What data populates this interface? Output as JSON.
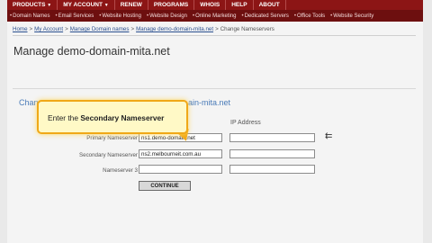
{
  "nav": {
    "top": [
      "PRODUCTS",
      "MY ACCOUNT",
      "RENEW",
      "PROGRAMS",
      "WHOIS",
      "HELP",
      "ABOUT"
    ],
    "sub": [
      "Domain Names",
      "Email Services",
      "Website Hosting",
      "Website Design",
      "Online Marketing",
      "Dedicated Servers",
      "Office Tools",
      "Website Security"
    ]
  },
  "breadcrumb": {
    "home": "Home",
    "my_account": "My Account",
    "manage_domains": "Manage Domain names",
    "manage_domain": "Manage demo-domain-mita.net",
    "current": "Change Nameservers",
    "separator": ">"
  },
  "page_title": "Manage demo-domain-mita.net",
  "section": {
    "title_left": "Chang",
    "title_right": "ain-mita.net"
  },
  "columns": {
    "ip": "IP Address"
  },
  "rows": [
    {
      "label": "Primary Nameserver",
      "value": "ns1.demo-domain.net",
      "ip": ""
    },
    {
      "label": "Secondary Nameserver",
      "value": "ns2.melbourneit.com.au",
      "ip": ""
    },
    {
      "label": "Nameserver 3",
      "value": "",
      "ip": ""
    }
  ],
  "continue_label": "CONTINUE",
  "callout": {
    "prefix": "Enter the ",
    "bold": "Secondary Nameserver"
  },
  "colors": {
    "nav_red": "#8c1515",
    "subnav_red": "#6d0f0f",
    "link_blue": "#2a4f8f",
    "callout_fill": "#fff9c6",
    "callout_border": "#f0a818"
  }
}
